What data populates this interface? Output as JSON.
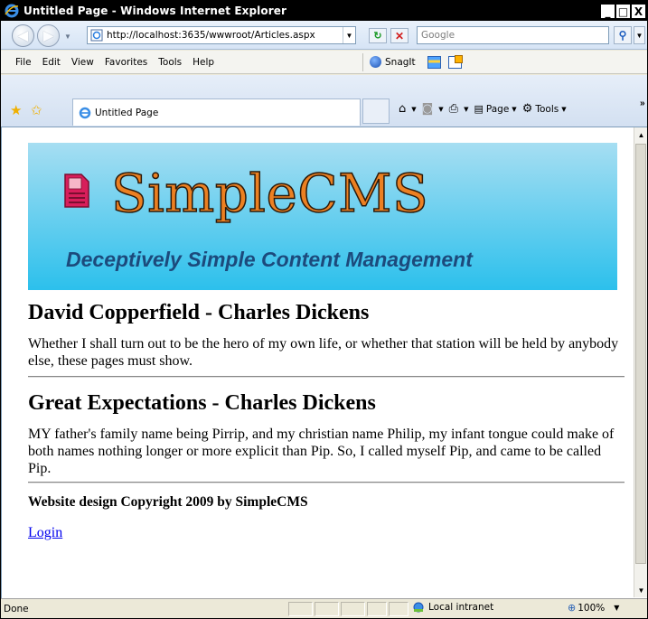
{
  "window": {
    "title": "Untitled Page - Windows Internet Explorer",
    "btn_min": "_",
    "btn_max": "□",
    "btn_close": "X"
  },
  "address": {
    "url": "http://localhost:3635/wwwroot/Articles.aspx",
    "search_placeholder": "Google"
  },
  "menu": {
    "items": [
      "File",
      "Edit",
      "View",
      "Favorites",
      "Tools",
      "Help"
    ],
    "snagit": "SnagIt"
  },
  "tab": {
    "label": "Untitled Page"
  },
  "commands": {
    "page": "Page",
    "tools": "Tools"
  },
  "banner": {
    "title": "SimpleCMS",
    "tagline": "Deceptively Simple Content Management"
  },
  "articles": [
    {
      "title": "David Copperfield - Charles Dickens",
      "body": "Whether I shall turn out to be the hero of my own life, or whether that station will be held by anybody else, these pages must show."
    },
    {
      "title": "Great Expectations - Charles Dickens",
      "body": "MY father's family name being Pirrip, and my christian name Philip, my infant tongue could make of both names nothing longer or more explicit than Pip. So, I called myself Pip, and came to be called Pip."
    }
  ],
  "footer": {
    "copyright": "Website design Copyright 2009 by SimpleCMS",
    "login_link": "Login"
  },
  "status": {
    "text": "Done",
    "zone": "Local intranet",
    "zoom": "100%"
  }
}
